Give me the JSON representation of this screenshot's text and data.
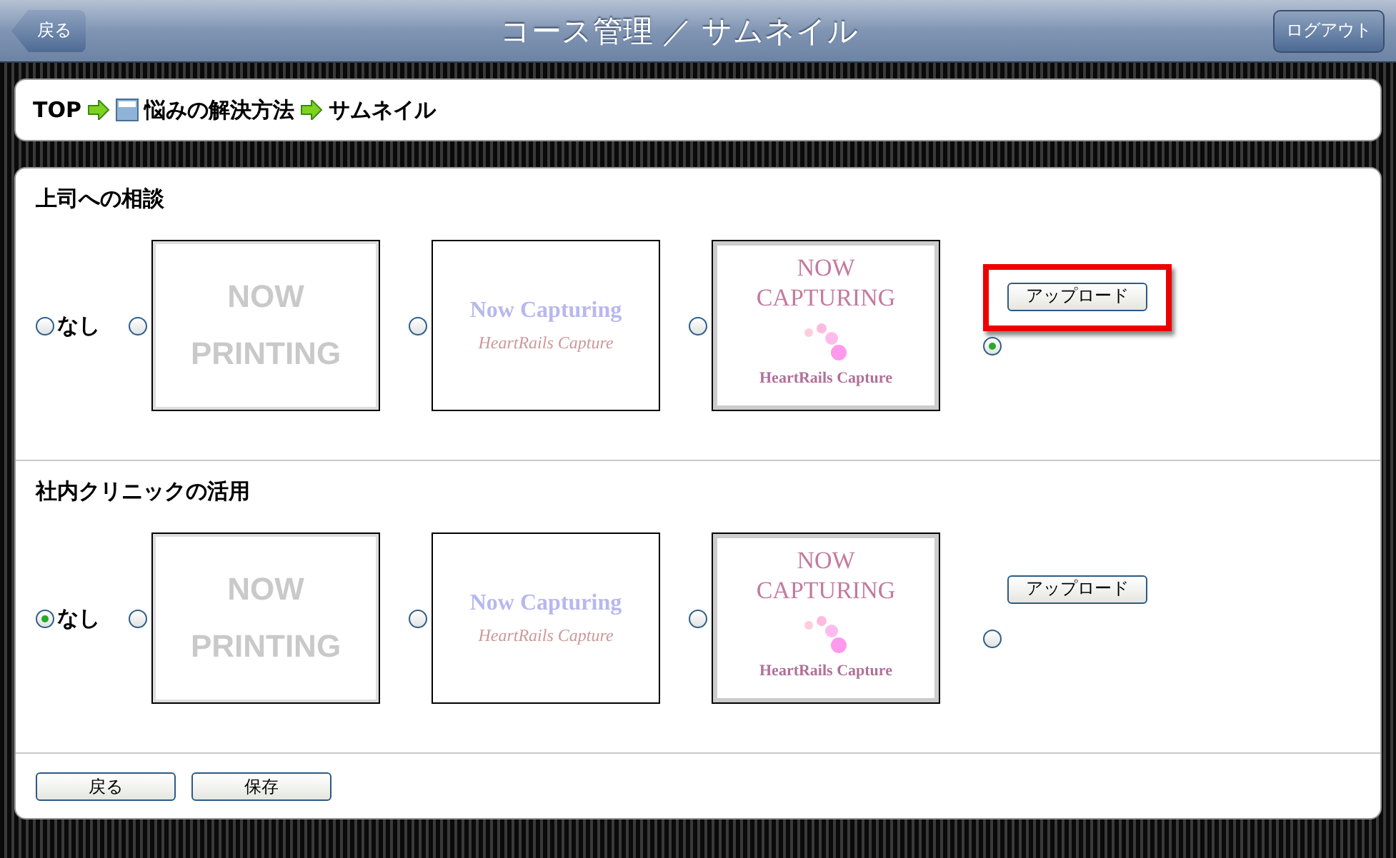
{
  "header": {
    "back_button": "戻る",
    "title": "コース管理 ／ サムネイル",
    "logout_button": "ログアウト"
  },
  "breadcrumb": [
    {
      "kind": "text",
      "label": "TOP"
    },
    {
      "kind": "page",
      "label": "悩みの解決方法"
    },
    {
      "kind": "text",
      "label": "サムネイル"
    }
  ],
  "sections": [
    {
      "title": "上司への相談",
      "options": [
        {
          "kind": "none",
          "label": "なし",
          "selected": false
        },
        {
          "kind": "printing",
          "lines": [
            "NOW",
            "PRINTING"
          ],
          "selected": false
        },
        {
          "kind": "capturing",
          "lines": [
            "Now Capturing",
            "HeartRails Capture"
          ],
          "selected": false
        },
        {
          "kind": "capturingbig",
          "lines": [
            "NOW",
            "CAPTURING",
            "HeartRails Capture"
          ],
          "selected": false
        },
        {
          "kind": "upload",
          "button": "アップロード",
          "selected": true,
          "highlighted": true
        }
      ]
    },
    {
      "title": "社内クリニックの活用",
      "options": [
        {
          "kind": "none",
          "label": "なし",
          "selected": true
        },
        {
          "kind": "printing",
          "lines": [
            "NOW",
            "PRINTING"
          ],
          "selected": false
        },
        {
          "kind": "capturing",
          "lines": [
            "Now Capturing",
            "HeartRails Capture"
          ],
          "selected": false
        },
        {
          "kind": "capturingbig",
          "lines": [
            "NOW",
            "CAPTURING",
            "HeartRails Capture"
          ],
          "selected": false
        },
        {
          "kind": "upload",
          "button": "アップロード",
          "selected": false,
          "highlighted": false
        }
      ]
    }
  ],
  "buttons": [
    "戻る",
    "保存"
  ]
}
